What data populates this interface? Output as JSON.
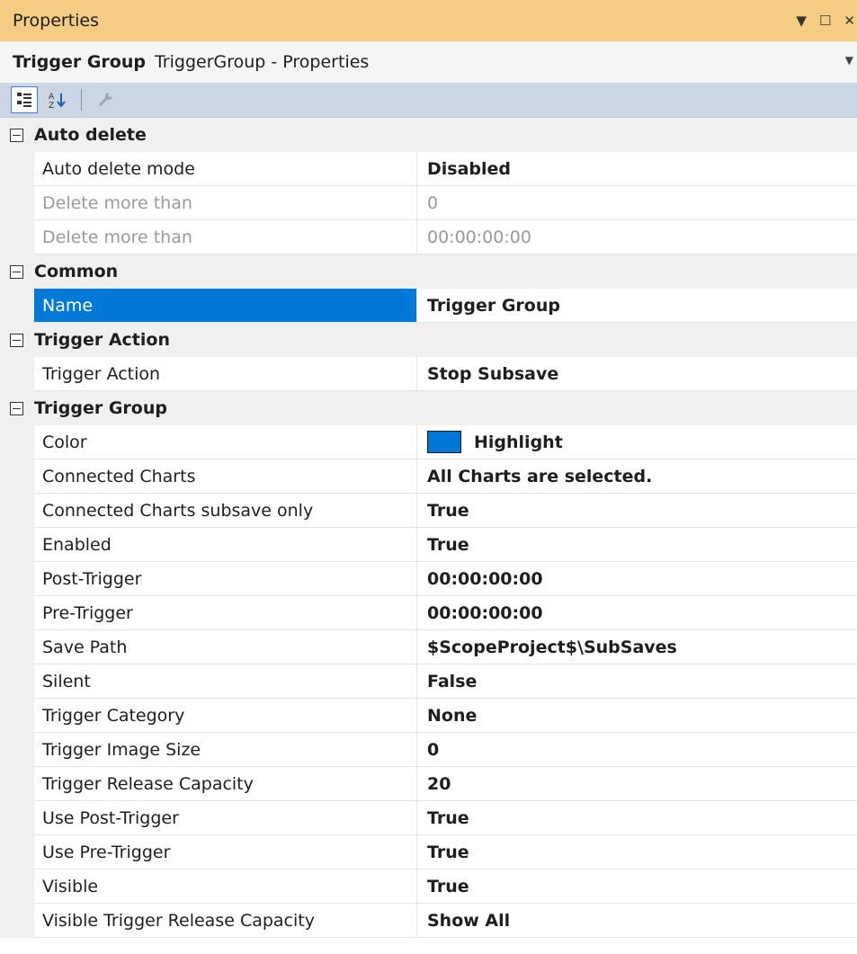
{
  "window": {
    "title": "Properties",
    "buttons": {
      "dropdown": "▼",
      "maximize": "☐",
      "close": "✕"
    }
  },
  "object_selector": {
    "name": "Trigger Group",
    "type": "TriggerGroup - Properties"
  },
  "toolbar": {
    "buttons": [
      {
        "icon": "categorized-icon",
        "active": true
      },
      {
        "icon": "alphabetical-icon",
        "active": false
      },
      {
        "icon": "wrench-icon",
        "active": false
      }
    ]
  },
  "categories": [
    {
      "label": "Auto delete",
      "rows": [
        {
          "name": "Auto delete mode",
          "value": "Disabled"
        },
        {
          "name": "Delete more than",
          "value": "0",
          "disabled": true
        },
        {
          "name": "Delete more than",
          "value": "00:00:00:00",
          "disabled": true
        }
      ]
    },
    {
      "label": "Common",
      "rows": [
        {
          "name": "Name",
          "value": "Trigger Group",
          "selected": true
        }
      ]
    },
    {
      "label": "Trigger Action",
      "rows": [
        {
          "name": "Trigger Action",
          "value": "Stop Subsave"
        }
      ]
    },
    {
      "label": "Trigger Group",
      "rows": [
        {
          "name": "Color",
          "value": "Highlight",
          "swatch": "#0078d7"
        },
        {
          "name": "Connected Charts",
          "value": "All Charts are selected."
        },
        {
          "name": "Connected Charts subsave only",
          "value": "True"
        },
        {
          "name": "Enabled",
          "value": "True"
        },
        {
          "name": "Post-Trigger",
          "value": "00:00:00:00"
        },
        {
          "name": "Pre-Trigger",
          "value": "00:00:00:00"
        },
        {
          "name": "Save Path",
          "value": "$ScopeProject$\\SubSaves"
        },
        {
          "name": "Silent",
          "value": "False"
        },
        {
          "name": "Trigger Category",
          "value": "None"
        },
        {
          "name": "Trigger Image Size",
          "value": "0"
        },
        {
          "name": "Trigger Release Capacity",
          "value": "20"
        },
        {
          "name": "Use Post-Trigger",
          "value": "True"
        },
        {
          "name": "Use Pre-Trigger",
          "value": "True"
        },
        {
          "name": "Visible",
          "value": "True"
        },
        {
          "name": "Visible Trigger Release Capacity",
          "value": "Show All"
        }
      ]
    }
  ],
  "colors": {
    "title_bg": "#f5cc84",
    "toolbar_bg": "#ccd5e3",
    "selection": "#0078d7"
  }
}
